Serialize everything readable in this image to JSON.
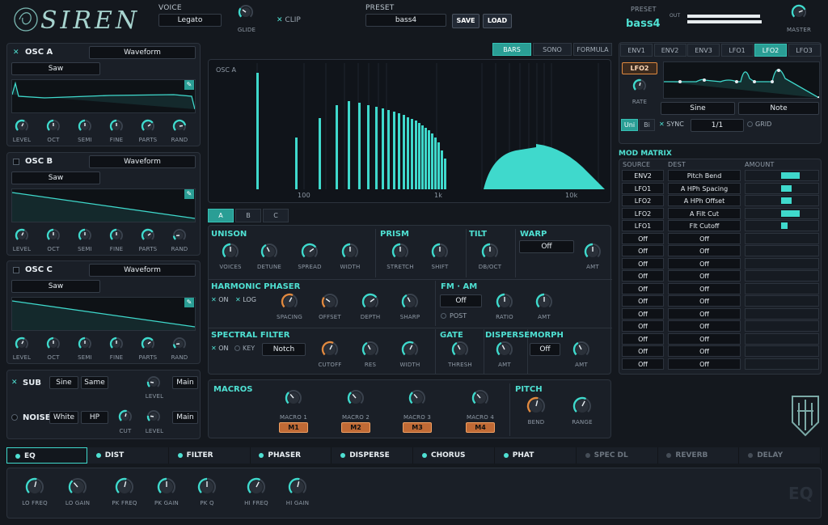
{
  "logo": "SIREN",
  "voice": {
    "label": "VOICE",
    "value": "Legato",
    "glide_label": "GLIDE",
    "clip_label": "CLIP"
  },
  "preset_top": {
    "label": "PRESET",
    "value": "bass4",
    "save": "SAVE",
    "load": "LOAD"
  },
  "preset_display": {
    "label": "PRESET",
    "value": "bass4",
    "out_label": "OUT",
    "master_label": "MASTER"
  },
  "osc_a": {
    "title": "OSC A",
    "mode": "Waveform",
    "wave": "Saw",
    "knobs": [
      "LEVEL",
      "OCT",
      "SEMI",
      "FINE",
      "PARTS",
      "RAND"
    ]
  },
  "osc_b": {
    "title": "OSC B",
    "mode": "Waveform",
    "wave": "Saw",
    "knobs": [
      "LEVEL",
      "OCT",
      "SEMI",
      "FINE",
      "PARTS",
      "RAND"
    ]
  },
  "osc_c": {
    "title": "OSC C",
    "mode": "Waveform",
    "wave": "Saw",
    "knobs": [
      "LEVEL",
      "OCT",
      "SEMI",
      "FINE",
      "PARTS",
      "RAND"
    ]
  },
  "sub": {
    "title": "SUB",
    "wave": "Sine",
    "mode": "Same",
    "level": "LEVEL",
    "out": "Main"
  },
  "noise": {
    "title": "NOISE",
    "type": "White",
    "filter": "HP",
    "cut": "CUT",
    "level": "LEVEL",
    "out": "Main"
  },
  "display": {
    "tabs": [
      "BARS",
      "SONO",
      "FORMULA"
    ],
    "label": "OSC A",
    "freq_labels": [
      "100",
      "1k",
      "10k"
    ]
  },
  "abc_tabs": [
    "A",
    "B",
    "C"
  ],
  "unison": {
    "title": "UNISON",
    "knobs": [
      "VOICES",
      "DETUNE",
      "SPREAD",
      "WIDTH"
    ]
  },
  "prism": {
    "title": "PRISM",
    "knobs": [
      "STRETCH",
      "SHIFT"
    ]
  },
  "tilt": {
    "title": "TILT",
    "knob": "DB/OCT"
  },
  "warp": {
    "title": "WARP",
    "value": "Off",
    "knob": "AMT"
  },
  "harmonic_phaser": {
    "title": "HARMONIC PHASER",
    "on": "ON",
    "log": "LOG",
    "knobs": [
      "SPACING",
      "OFFSET",
      "DEPTH",
      "SHARP"
    ]
  },
  "fm_am": {
    "title": "FM · AM",
    "value": "Off",
    "post": "POST",
    "knobs": [
      "RATIO",
      "AMT"
    ]
  },
  "spectral_filter": {
    "title": "SPECTRAL FILTER",
    "on": "ON",
    "key": "KEY",
    "type": "Notch",
    "knobs": [
      "CUTOFF",
      "RES",
      "WIDTH"
    ]
  },
  "gate": {
    "title": "GATE",
    "knob": "THRESH"
  },
  "disperse": {
    "title": "DISPERSE",
    "knob": "AMT"
  },
  "morph": {
    "title": "MORPH",
    "value": "Off",
    "knob": "AMT"
  },
  "macros": {
    "title": "MACROS",
    "items": [
      {
        "label": "MACRO 1",
        "btn": "M1"
      },
      {
        "label": "MACRO 2",
        "btn": "M2"
      },
      {
        "label": "MACRO 3",
        "btn": "M3"
      },
      {
        "label": "MACRO 4",
        "btn": "M4"
      }
    ]
  },
  "pitch": {
    "title": "PITCH",
    "knobs": [
      "BEND",
      "RANGE"
    ]
  },
  "mod_tabs": [
    "ENV1",
    "ENV2",
    "ENV3",
    "LFO1",
    "LFO2",
    "LFO3"
  ],
  "lfo": {
    "name": "LFO2",
    "rate": "RATE",
    "shape": "Sine",
    "mode": "Note",
    "uni": "Uni",
    "bi": "Bi",
    "sync": "SYNC",
    "div": "1/1",
    "grid": "GRID"
  },
  "mod_matrix": {
    "title": "MOD MATRIX",
    "headers": [
      "SOURCE",
      "DEST",
      "AMOUNT"
    ],
    "rows": [
      {
        "src": "ENV2",
        "dest": "Pitch Bend",
        "amt": 0.55
      },
      {
        "src": "LFO1",
        "dest": "A HPh Spacing",
        "amt": 0.3
      },
      {
        "src": "LFO2",
        "dest": "A HPh Offset",
        "amt": 0.3
      },
      {
        "src": "LFO2",
        "dest": "A Filt Cut",
        "amt": 0.55
      },
      {
        "src": "LFO1",
        "dest": "Flt Cutoff",
        "amt": 0.18
      },
      {
        "src": "Off",
        "dest": "Off",
        "amt": 0
      },
      {
        "src": "Off",
        "dest": "Off",
        "amt": 0
      },
      {
        "src": "Off",
        "dest": "Off",
        "amt": 0
      },
      {
        "src": "Off",
        "dest": "Off",
        "amt": 0
      },
      {
        "src": "Off",
        "dest": "Off",
        "amt": 0
      },
      {
        "src": "Off",
        "dest": "Off",
        "amt": 0
      },
      {
        "src": "Off",
        "dest": "Off",
        "amt": 0
      },
      {
        "src": "Off",
        "dest": "Off",
        "amt": 0
      },
      {
        "src": "Off",
        "dest": "Off",
        "amt": 0
      },
      {
        "src": "Off",
        "dest": "Off",
        "amt": 0
      },
      {
        "src": "Off",
        "dest": "Off",
        "amt": 0
      }
    ]
  },
  "fx_tabs": [
    {
      "name": "EQ",
      "on": true
    },
    {
      "name": "DIST",
      "on": true
    },
    {
      "name": "FILTER",
      "on": true
    },
    {
      "name": "PHASER",
      "on": true
    },
    {
      "name": "DISPERSE",
      "on": true
    },
    {
      "name": "CHORUS",
      "on": true
    },
    {
      "name": "PHAT",
      "on": true
    },
    {
      "name": "SPEC DL",
      "on": false
    },
    {
      "name": "REVERB",
      "on": false
    },
    {
      "name": "DELAY",
      "on": false
    }
  ],
  "eq": {
    "title": "EQ",
    "knobs": [
      "LO FREQ",
      "LO GAIN",
      "PK FREQ",
      "PK GAIN",
      "PK Q",
      "HI FREQ",
      "HI GAIN"
    ]
  },
  "colors": {
    "accent": "#4fe0d2",
    "orange": "#e0893f",
    "panel": "#1a1f27"
  }
}
